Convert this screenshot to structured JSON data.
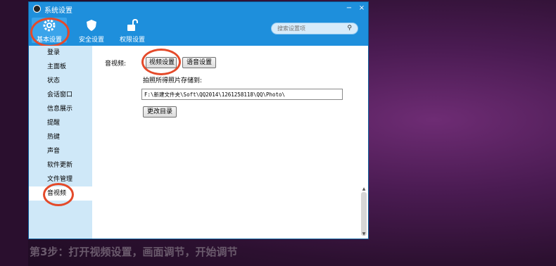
{
  "window": {
    "title": "系统设置",
    "minimize": "−",
    "close": "×"
  },
  "toolbar": {
    "tabs": [
      {
        "label": "基本设置",
        "icon": "gear-icon"
      },
      {
        "label": "安全设置",
        "icon": "shield-icon"
      },
      {
        "label": "权限设置",
        "icon": "unlock-icon"
      }
    ]
  },
  "search": {
    "placeholder": "搜索设置项",
    "icon": "search-icon"
  },
  "sidebar": {
    "items": [
      {
        "label": "登录"
      },
      {
        "label": "主面板"
      },
      {
        "label": "状态"
      },
      {
        "label": "会话窗口"
      },
      {
        "label": "信息展示"
      },
      {
        "label": "提醒"
      },
      {
        "label": "热键"
      },
      {
        "label": "声音"
      },
      {
        "label": "软件更新"
      },
      {
        "label": "文件管理"
      },
      {
        "label": "音视频"
      }
    ],
    "selected": "音视频"
  },
  "content": {
    "section_label": "音视频:",
    "video_button": "视频设置",
    "audio_button": "语音设置",
    "photo_label": "拍照所得照片存储到:",
    "photo_path": "F:\\新建文件夹\\Soft\\QQ2014\\1261258118\\QQ\\Photo\\",
    "change_dir_button": "更改目录"
  },
  "caption": "第3步：打开视频设置，画面调节，开始调节",
  "colors": {
    "accent": "#1e8fdc",
    "highlight_ring": "#e44a2a"
  }
}
